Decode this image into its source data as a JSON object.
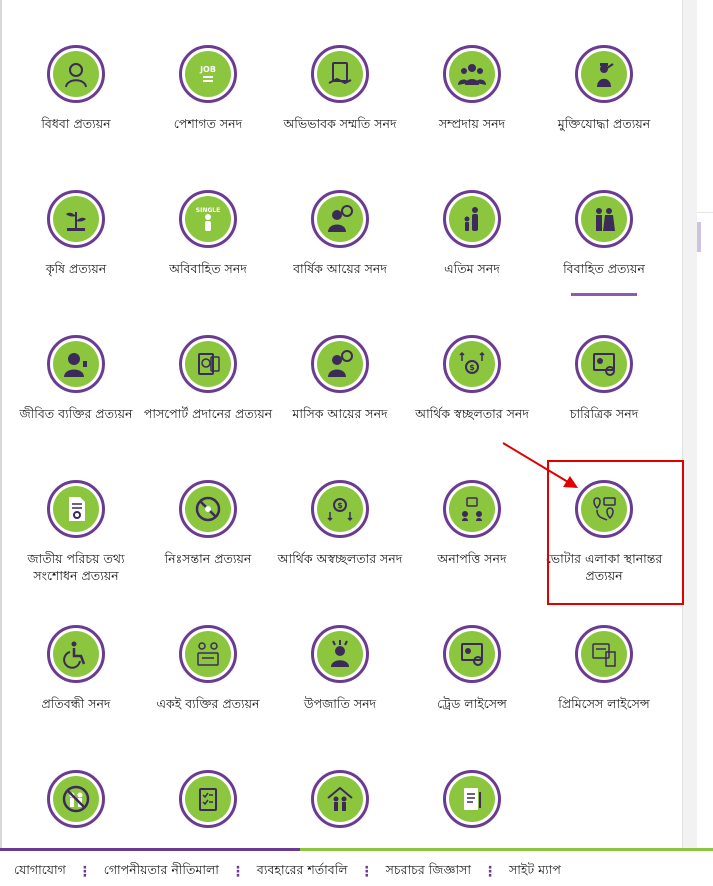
{
  "rows": [
    [
      {
        "name": "item-widow",
        "label": "বিধবা প্রত্যয়ন",
        "icon": "widow-icon"
      },
      {
        "name": "item-occupation",
        "label": "পেশাগত সনদ",
        "icon": "job-icon"
      },
      {
        "name": "item-guardian-consent",
        "label": "অভিভাবক সম্মতি সনদ",
        "icon": "document-hand-icon"
      },
      {
        "name": "item-community",
        "label": "সম্প্রদায় সনদ",
        "icon": "group-icon"
      },
      {
        "name": "item-freedom-fighter",
        "label": "মুক্তিযোদ্ধা প্রত্যয়ন",
        "icon": "salute-icon"
      }
    ],
    [
      {
        "name": "item-agriculture",
        "label": "কৃষি প্রত্যয়ন",
        "icon": "plant-icon"
      },
      {
        "name": "item-unmarried",
        "label": "অবিবাহিত সনদ",
        "icon": "single-person-icon",
        "badge": "SINGLE"
      },
      {
        "name": "item-annual-income",
        "label": "বার্ষিক আয়ের সনদ",
        "icon": "person-money-icon"
      },
      {
        "name": "item-orphan",
        "label": "এতিম সনদ",
        "icon": "adult-child-icon"
      },
      {
        "name": "item-married",
        "label": "বিবাহিত প্রত্যয়ন",
        "icon": "couple-icon",
        "active": true
      }
    ],
    [
      {
        "name": "item-living-person",
        "label": "জীবিত ব্যক্তির প্রত্যয়ন",
        "icon": "person-thumb-icon"
      },
      {
        "name": "item-passport",
        "label": "পাসপোর্ট প্রদানের প্রত্যয়ন",
        "icon": "passport-icon"
      },
      {
        "name": "item-monthly-income",
        "label": "মাসিক আয়ের সনদ",
        "icon": "person-money-icon"
      },
      {
        "name": "item-financial-solvency",
        "label": "আর্থিক স্বচ্ছলতার সনদ",
        "icon": "money-up-icon"
      },
      {
        "name": "item-character",
        "label": "চারিত্রিক সনদ",
        "icon": "certificate-person-icon"
      }
    ],
    [
      {
        "name": "item-nid-correction",
        "label": "জাতীয় পরিচয় তথ্য সংশোধন প্রত্যয়ন",
        "icon": "document-gear-icon"
      },
      {
        "name": "item-childless",
        "label": "নিঃসন্তান প্রত্যয়ন",
        "icon": "no-baby-icon"
      },
      {
        "name": "item-financial-insolvency",
        "label": "আর্থিক অস্বচ্ছলতার সনদ",
        "icon": "money-down-icon"
      },
      {
        "name": "item-no-objection",
        "label": "অনাপত্তি সনদ",
        "icon": "people-exchange-icon"
      },
      {
        "name": "item-voter-area-transfer",
        "label": "ভোটার এলাকা স্থানান্তর প্রত্যয়ন",
        "icon": "location-transfer-icon"
      }
    ],
    [
      {
        "name": "item-disability",
        "label": "প্রতিবন্ধী সনদ",
        "icon": "wheelchair-icon"
      },
      {
        "name": "item-same-person",
        "label": "একই ব্যক্তির প্রত্যয়ন",
        "icon": "two-persons-card-icon"
      },
      {
        "name": "item-tribal",
        "label": "উপজাতি সনদ",
        "icon": "tribal-person-icon"
      },
      {
        "name": "item-trade-license",
        "label": "ট্রেড লাইসেন্স",
        "icon": "certificate-person-icon"
      },
      {
        "name": "item-premises-license",
        "label": "প্রিমিসেস লাইসেন্স",
        "icon": "building-certificate-icon"
      }
    ],
    [
      {
        "name": "item-row6-1",
        "label": "",
        "icon": "no-family-icon"
      },
      {
        "name": "item-row6-2",
        "label": "",
        "icon": "checklist-icon"
      },
      {
        "name": "item-row6-3",
        "label": "",
        "icon": "family-house-icon"
      },
      {
        "name": "item-row6-4",
        "label": "",
        "icon": "document-pen-icon"
      }
    ]
  ],
  "footer": {
    "links": [
      "যোগাযোগ",
      "গোপনীয়তার নীতিমালা",
      "ব্যবহারের শর্তাবলি",
      "সচরাচর জিজ্ঞাসা",
      "সাইট ম্যাপ"
    ],
    "separator": "⋮"
  },
  "colors": {
    "accent_green": "#8cc63f",
    "accent_purple": "#6b3b93",
    "highlight_red": "#e00000"
  }
}
